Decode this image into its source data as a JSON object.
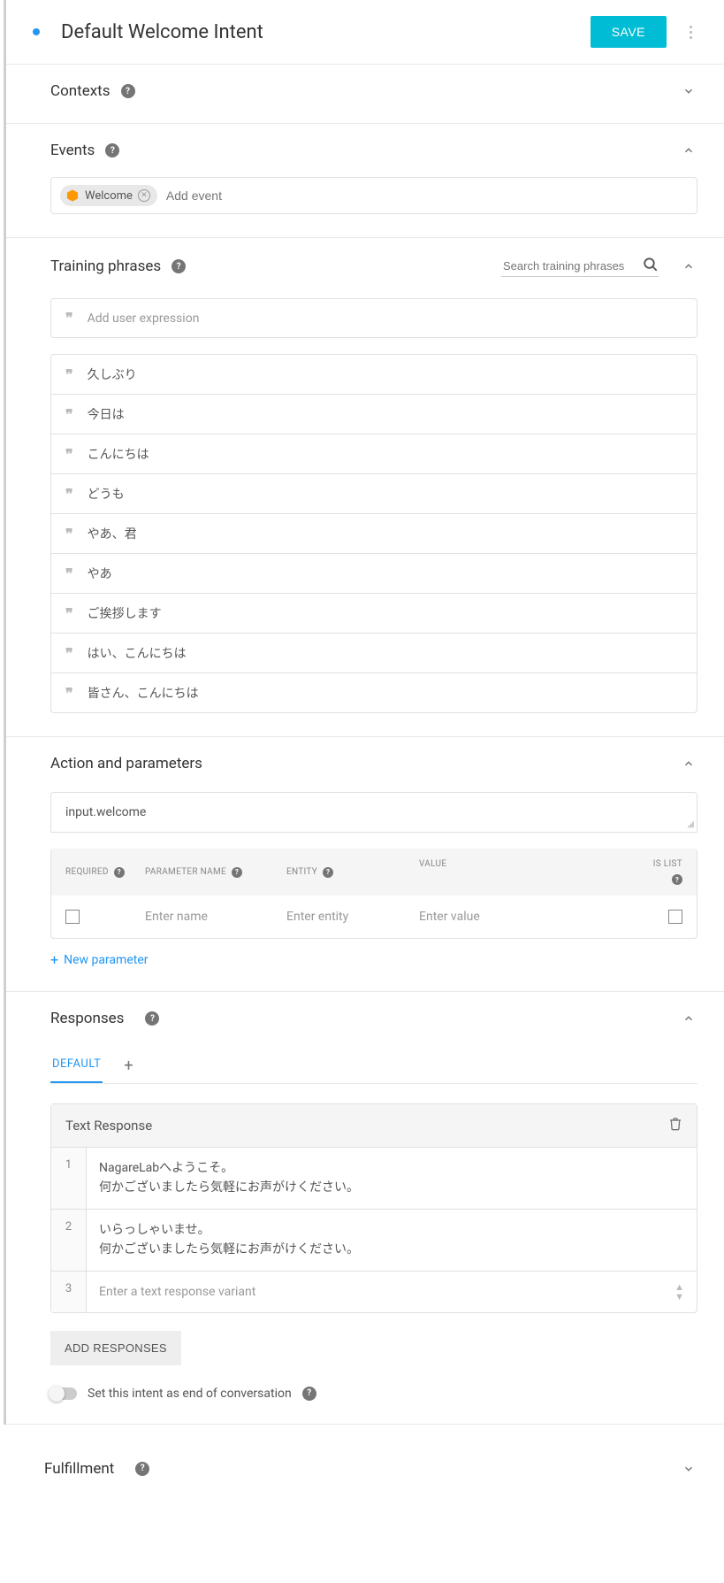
{
  "header": {
    "title": "Default Welcome Intent",
    "save_label": "SAVE"
  },
  "contexts": {
    "title": "Contexts"
  },
  "events": {
    "title": "Events",
    "chip": "Welcome",
    "add_placeholder": "Add event"
  },
  "training": {
    "title": "Training phrases",
    "search_placeholder": "Search training phrases",
    "add_placeholder": "Add user expression",
    "phrases": [
      "久しぶり",
      "今日は",
      "こんにちは",
      "どうも",
      "やあ、君",
      "やあ",
      "ご挨拶します",
      "はい、こんにちは",
      "皆さん、こんにちは"
    ]
  },
  "action": {
    "title": "Action and parameters",
    "input_value": "input.welcome",
    "headers": {
      "required": "REQUIRED",
      "param_name": "PARAMETER NAME",
      "entity": "ENTITY",
      "value": "VALUE",
      "is_list": "IS LIST"
    },
    "placeholders": {
      "name": "Enter name",
      "entity": "Enter entity",
      "value": "Enter value"
    },
    "new_param": "New parameter"
  },
  "responses": {
    "title": "Responses",
    "tab_default": "DEFAULT",
    "text_response_title": "Text Response",
    "rows": [
      "NagareLabへようこそ。\n何かございましたら気軽にお声がけください。",
      "いらっしゃいませ。\n何かございましたら気軽にお声がけください。"
    ],
    "variant_placeholder": "Enter a text response variant",
    "add_responses": "ADD RESPONSES",
    "end_conv_label": "Set this intent as end of conversation"
  },
  "fulfillment": {
    "title": "Fulfillment"
  }
}
